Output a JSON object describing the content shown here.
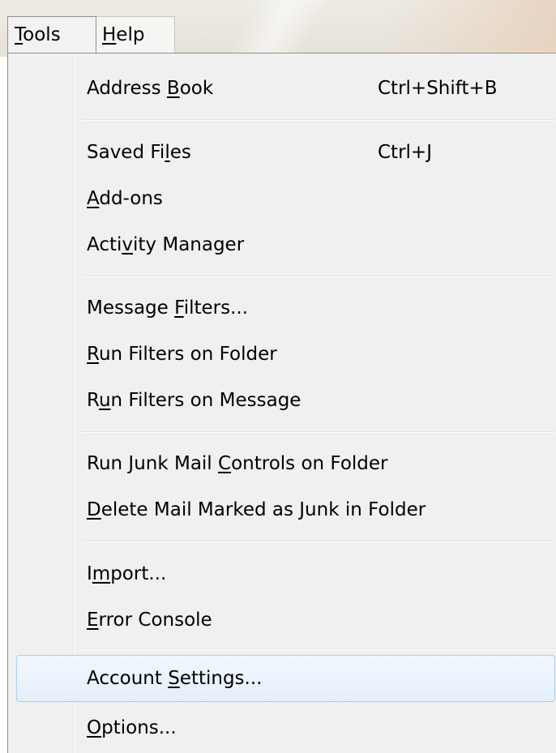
{
  "menubar": {
    "items": [
      {
        "pre": "",
        "accel": "T",
        "post": "ools"
      },
      {
        "pre": "",
        "accel": "H",
        "post": "elp"
      }
    ]
  },
  "menu": {
    "items": [
      {
        "pre": "Address ",
        "accel": "B",
        "post": "ook",
        "shortcut": "Ctrl+Shift+B"
      },
      {
        "pre": "Saved Fi",
        "accel": "l",
        "post": "es",
        "shortcut": "Ctrl+J"
      },
      {
        "pre": "",
        "accel": "A",
        "post": "dd-ons",
        "shortcut": ""
      },
      {
        "pre": "Acti",
        "accel": "v",
        "post": "ity Manager",
        "shortcut": ""
      },
      {
        "pre": "Message ",
        "accel": "F",
        "post": "ilters...",
        "shortcut": ""
      },
      {
        "pre": "",
        "accel": "R",
        "post": "un Filters on Folder",
        "shortcut": ""
      },
      {
        "pre": "R",
        "accel": "u",
        "post": "n Filters on Message",
        "shortcut": ""
      },
      {
        "pre": "Run Junk Mail ",
        "accel": "C",
        "post": "ontrols on Folder",
        "shortcut": ""
      },
      {
        "pre": "",
        "accel": "D",
        "post": "elete Mail Marked as Junk in Folder",
        "shortcut": ""
      },
      {
        "pre": "I",
        "accel": "m",
        "post": "port...",
        "shortcut": ""
      },
      {
        "pre": "",
        "accel": "E",
        "post": "rror Console",
        "shortcut": ""
      },
      {
        "pre": "Account ",
        "accel": "S",
        "post": "ettings...",
        "shortcut": ""
      },
      {
        "pre": "",
        "accel": "O",
        "post": "ptions...",
        "shortcut": ""
      }
    ]
  },
  "colors": {
    "menu_background": "#f0f0f0",
    "highlight_border": "#a8d0f2",
    "highlight_fill": "#e4effb"
  }
}
